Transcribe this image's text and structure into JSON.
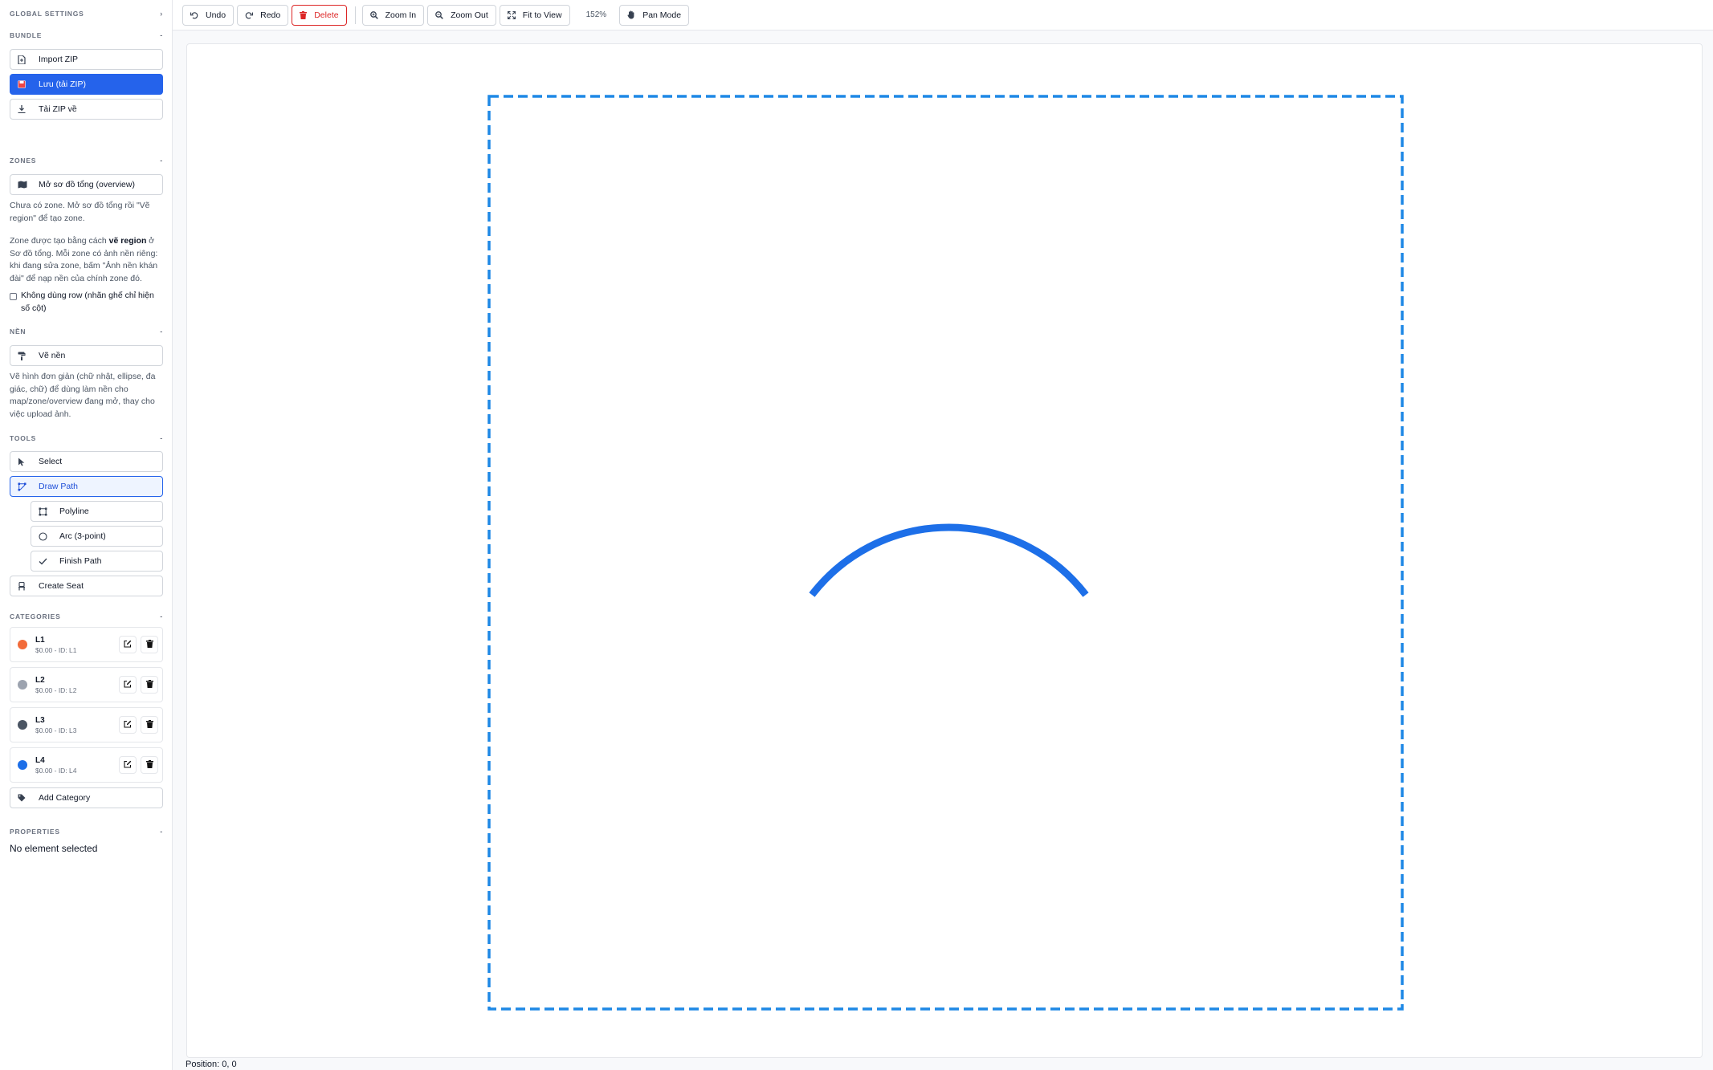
{
  "sidebar": {
    "global_settings": {
      "title": "GLOBAL SETTINGS"
    },
    "bundle": {
      "title": "BUNDLE",
      "import_label": "Import ZIP",
      "save_label": "Lưu (tải ZIP)",
      "download_label": "Tải ZIP về"
    },
    "zones": {
      "title": "ZONES",
      "open_overview_label": "Mở sơ đồ tổng (overview)",
      "empty_text": "Chưa có zone. Mở sơ đồ tổng rồi \"Vẽ region\" để tạo zone.",
      "help_pre": "Zone được tạo bằng cách ",
      "help_bold": "vẽ region",
      "help_post": " ở Sơ đồ tổng. Mỗi zone có ảnh nền riêng: khi đang sửa zone, bấm \"Ảnh nền khán đài\" để nạp nền của chính zone đó.",
      "no_row_label": "Không dùng row (nhãn ghế chỉ hiện số cột)"
    },
    "background": {
      "title": "NỀN",
      "draw_label": "Vẽ nền",
      "help": "Vẽ hình đơn giản (chữ nhật, ellipse, đa giác, chữ) để dùng làm nền cho map/zone/overview đang mở, thay cho việc upload ảnh."
    },
    "tools": {
      "title": "TOOLS",
      "select_label": "Select",
      "draw_path_label": "Draw Path",
      "polyline_label": "Polyline",
      "arc_label": "Arc (3-point)",
      "finish_label": "Finish Path",
      "create_seat_label": "Create Seat"
    },
    "categories": {
      "title": "CATEGORIES",
      "items": [
        {
          "name": "L1",
          "meta": "$0.00 - ID: L1",
          "color": "#f26b3a"
        },
        {
          "name": "L2",
          "meta": "$0.00 - ID: L2",
          "color": "#9ca3af"
        },
        {
          "name": "L3",
          "meta": "$0.00 - ID: L3",
          "color": "#4b5563"
        },
        {
          "name": "L4",
          "meta": "$0.00 - ID: L4",
          "color": "#1d6fe8"
        }
      ],
      "add_label": "Add Category"
    },
    "properties": {
      "title": "PROPERTIES",
      "empty": "No element selected"
    }
  },
  "toolbar": {
    "undo": "Undo",
    "redo": "Redo",
    "delete": "Delete",
    "zoom_in": "Zoom In",
    "zoom_out": "Zoom Out",
    "fit": "Fit to View",
    "zoom_level": "152%",
    "pan": "Pan Mode"
  },
  "canvas": {
    "accent": "#1d6fe8",
    "border_color": "#1e88e5"
  },
  "status": {
    "position": "Position: 0, 0"
  }
}
